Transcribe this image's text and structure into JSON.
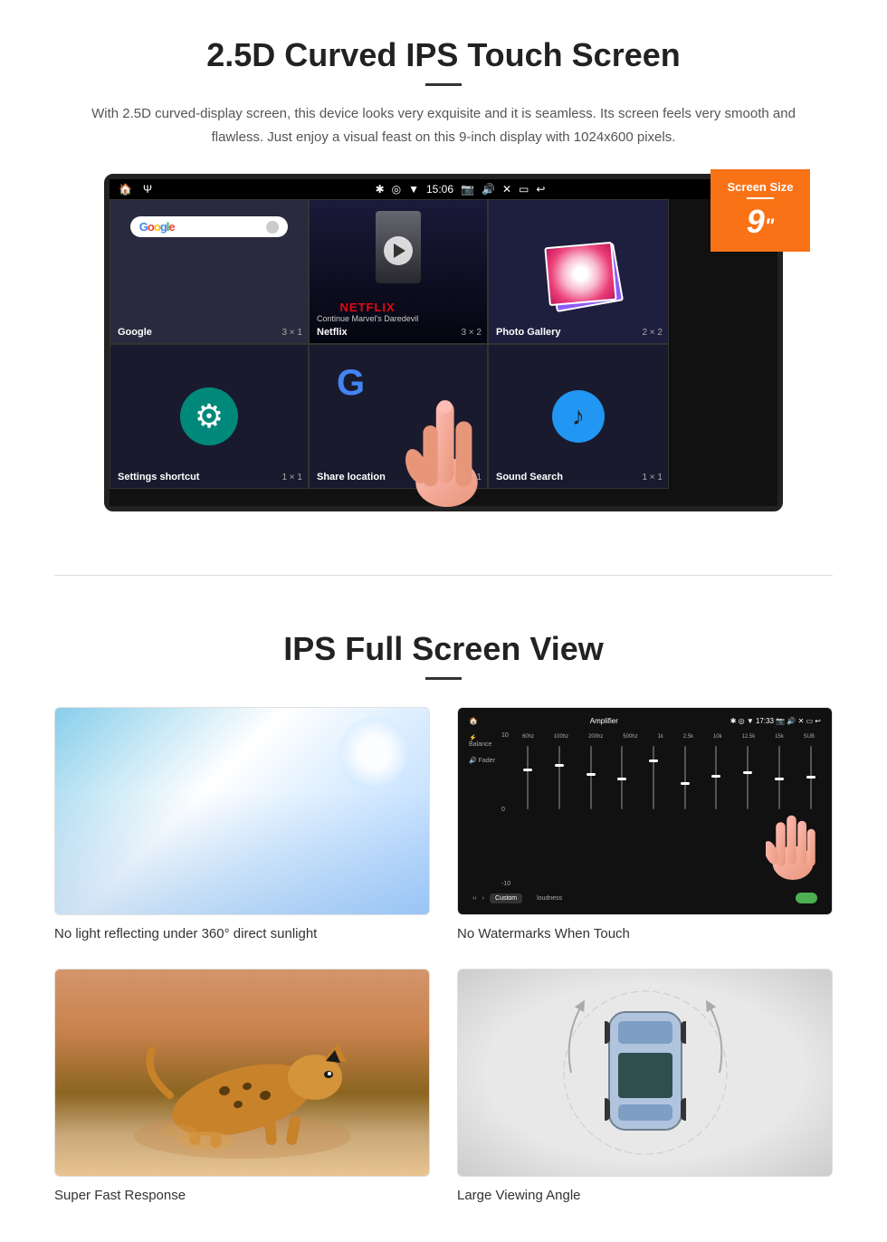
{
  "section1": {
    "title": "2.5D Curved IPS Touch Screen",
    "description": "With 2.5D curved-display screen, this device looks very exquisite and it is seamless. Its screen feels very smooth and flawless. Just enjoy a visual feast on this 9-inch display with 1024x600 pixels.",
    "badge": {
      "title": "Screen Size",
      "size": "9",
      "unit": "\""
    },
    "statusbar": {
      "time": "15:06"
    },
    "grid": {
      "cells": [
        {
          "label": "Google",
          "size": "3 × 1"
        },
        {
          "label": "Netflix",
          "size": "3 × 2"
        },
        {
          "label": "Photo Gallery",
          "size": "2 × 2"
        },
        {
          "label": "",
          "size": ""
        },
        {
          "label": "Settings shortcut",
          "size": "1 × 1"
        },
        {
          "label": "Share location",
          "size": "1 × 1"
        },
        {
          "label": "Sound Search",
          "size": "1 × 1"
        },
        {
          "label": "",
          "size": ""
        }
      ]
    },
    "netflix": {
      "brand": "NETFLIX",
      "subtitle": "Continue Marvel's Daredevil"
    }
  },
  "section2": {
    "title": "IPS Full Screen View",
    "features": [
      {
        "id": "sunlight",
        "caption": "No light reflecting under 360° direct sunlight"
      },
      {
        "id": "equalizer",
        "caption": "No Watermarks When Touch"
      },
      {
        "id": "cheetah",
        "caption": "Super Fast Response"
      },
      {
        "id": "car",
        "caption": "Large Viewing Angle"
      }
    ]
  }
}
